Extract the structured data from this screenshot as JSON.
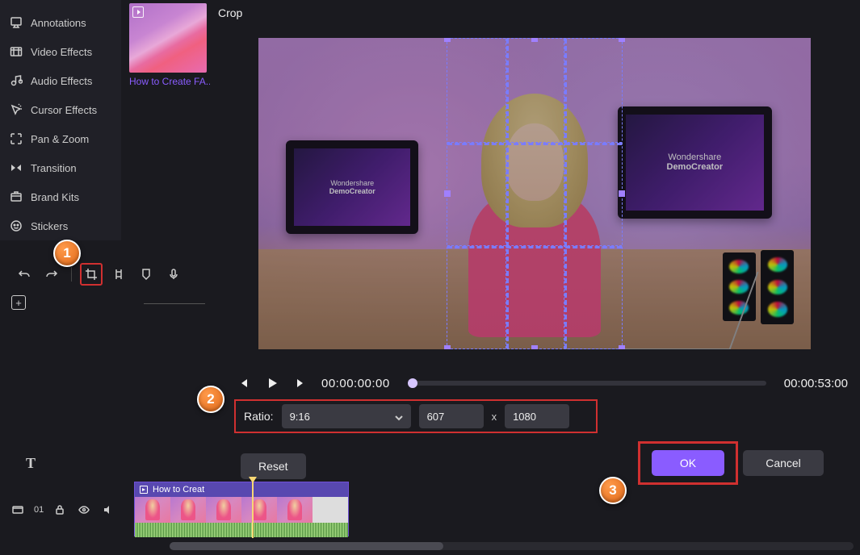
{
  "panel_title": "Crop",
  "sidebar": {
    "items": [
      {
        "label": "Annotations",
        "icon": "annotations"
      },
      {
        "label": "Video Effects",
        "icon": "video-effects"
      },
      {
        "label": "Audio Effects",
        "icon": "audio-effects"
      },
      {
        "label": "Cursor Effects",
        "icon": "cursor-effects"
      },
      {
        "label": "Pan & Zoom",
        "icon": "pan-zoom"
      },
      {
        "label": "Transition",
        "icon": "transition"
      },
      {
        "label": "Brand Kits",
        "icon": "brand-kits"
      },
      {
        "label": "Stickers",
        "icon": "stickers"
      }
    ]
  },
  "media_thumb": {
    "label": "How to Create FA..."
  },
  "playback": {
    "current": "00:00:00:00",
    "duration": "00:00:53:00"
  },
  "crop": {
    "ratio_label": "Ratio:",
    "ratio_value": "9:16",
    "width": "607",
    "height": "1080",
    "separator": "x"
  },
  "buttons": {
    "reset": "Reset",
    "ok": "OK",
    "cancel": "Cancel"
  },
  "badges": {
    "one": "1",
    "two": "2",
    "three": "3"
  },
  "timeline": {
    "clip_title": "How to Creat",
    "track_num": "01"
  },
  "monitor_brand_line1": "Wondershare",
  "monitor_brand_line2": "DemoCreator"
}
